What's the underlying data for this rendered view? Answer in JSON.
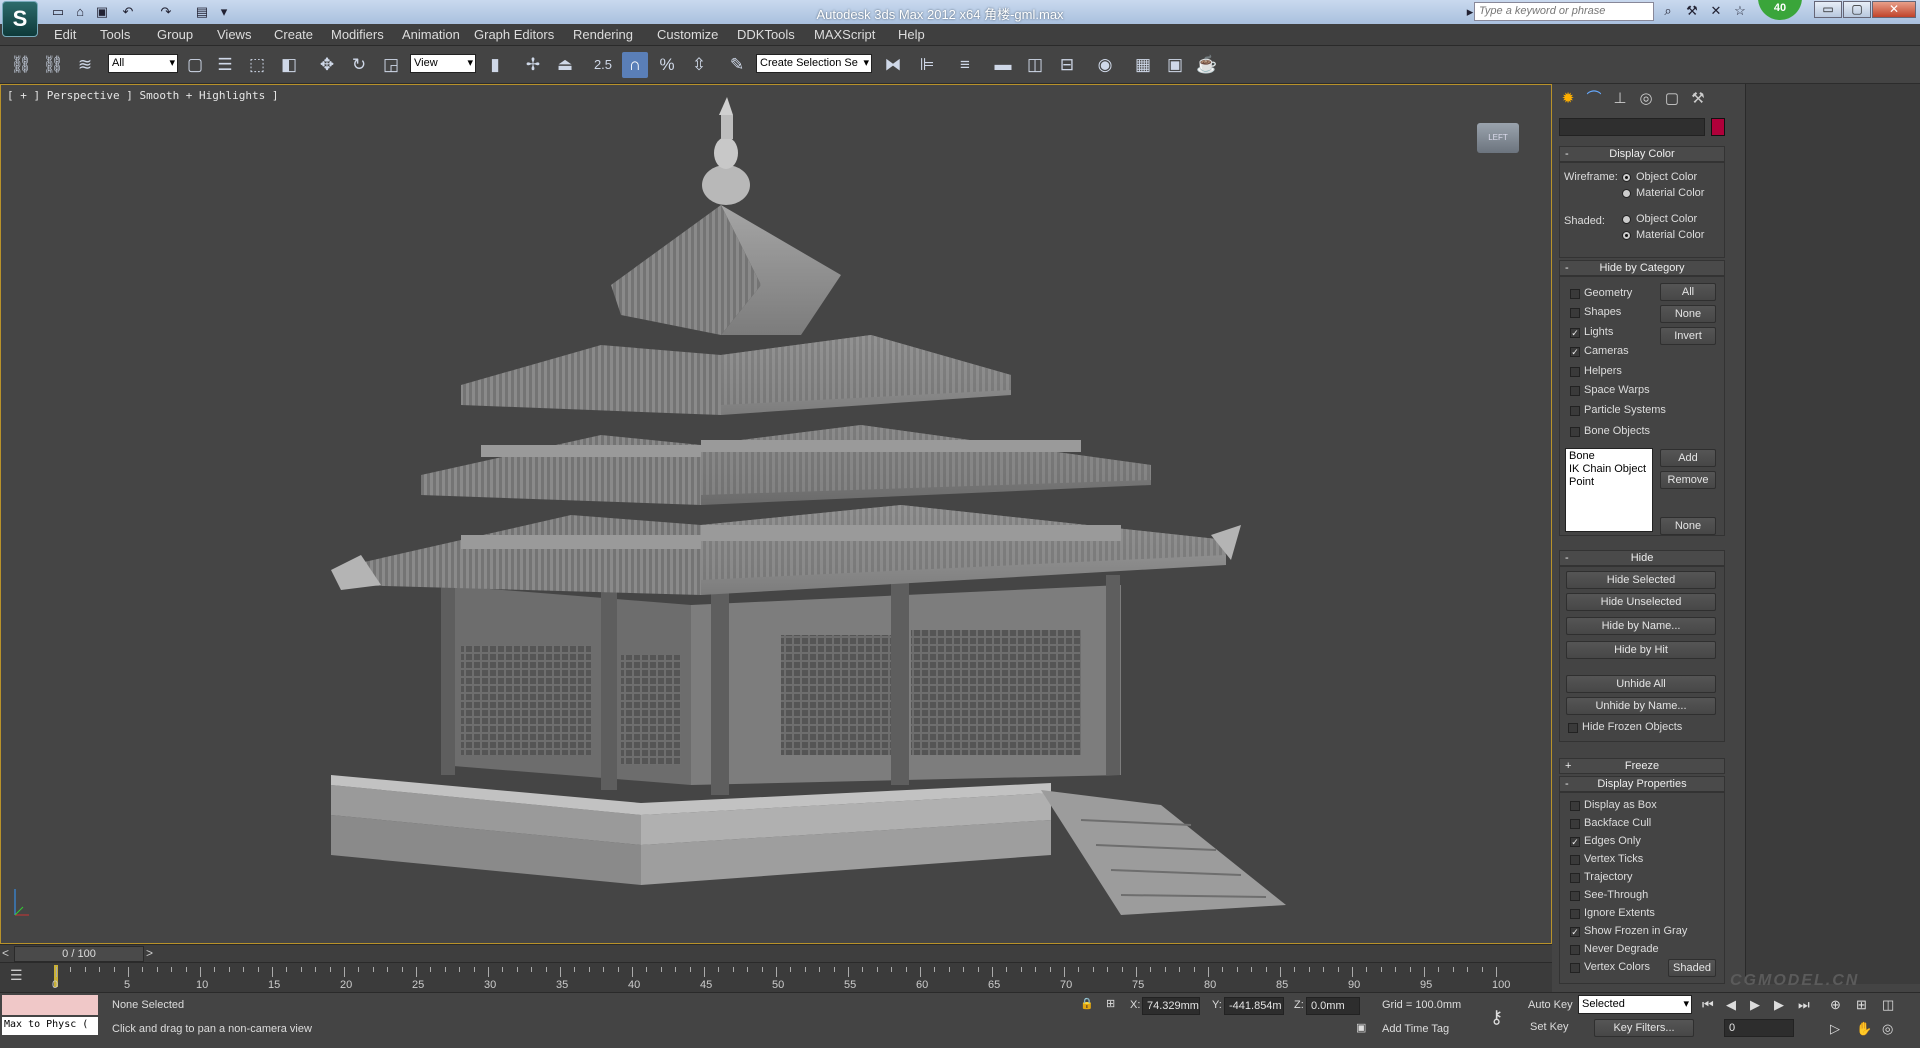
{
  "window": {
    "title": "Autodesk 3ds Max  2012 x64     角楼-gml.max",
    "logo": "S",
    "search_placeholder": "Type a keyword or phrase",
    "badge": "40",
    "min": "▭",
    "max": "▢",
    "close": "✕"
  },
  "menu": [
    "Edit",
    "Tools",
    "Group",
    "Views",
    "Create",
    "Modifiers",
    "Animation",
    "Graph Editors",
    "Rendering",
    "Customize",
    "DDKTools",
    "MAXScript",
    "Help"
  ],
  "toolbar": {
    "filter_value": "All",
    "refcoord_value": "View",
    "snap_label": "2.5",
    "percent_label": "%",
    "selection_set_value": "Create Selection Se"
  },
  "viewport": {
    "label": "[ + ] Perspective ] Smooth + Highlights ]",
    "viewcube_text": "LEFT"
  },
  "panel": {
    "display_color": {
      "title": "Display Color",
      "wireframe_label": "Wireframe:",
      "shaded_label": "Shaded:",
      "object_color": "Object Color",
      "material_color": "Material Color"
    },
    "hide_by_category": {
      "title": "Hide by Category",
      "items": [
        {
          "label": "Geometry",
          "checked": false
        },
        {
          "label": "Shapes",
          "checked": false
        },
        {
          "label": "Lights",
          "checked": true
        },
        {
          "label": "Cameras",
          "checked": true
        },
        {
          "label": "Helpers",
          "checked": false
        },
        {
          "label": "Space Warps",
          "checked": false
        },
        {
          "label": "Particle Systems",
          "checked": false
        },
        {
          "label": "Bone Objects",
          "checked": false
        }
      ],
      "all": "All",
      "none": "None",
      "invert": "Invert",
      "list": [
        "Bone",
        "IK Chain Object",
        "Point"
      ],
      "add": "Add",
      "remove": "Remove",
      "list_none": "None"
    },
    "hide": {
      "title": "Hide",
      "buttons": [
        "Hide Selected",
        "Hide Unselected",
        "Hide by Name...",
        "Hide by Hit",
        "Unhide All",
        "Unhide by Name..."
      ],
      "hide_frozen": "Hide Frozen Objects"
    },
    "freeze": {
      "title": "Freeze"
    },
    "display_properties": {
      "title": "Display Properties",
      "items": [
        {
          "label": "Display as Box",
          "checked": false
        },
        {
          "label": "Backface Cull",
          "checked": false
        },
        {
          "label": "Edges Only",
          "checked": true
        },
        {
          "label": "Vertex Ticks",
          "checked": false
        },
        {
          "label": "Trajectory",
          "checked": false
        },
        {
          "label": "See-Through",
          "checked": false
        },
        {
          "label": "Ignore Extents",
          "checked": false
        },
        {
          "label": "Show Frozen in Gray",
          "checked": true
        },
        {
          "label": "Never Degrade",
          "checked": false
        },
        {
          "label": "Vertex Colors",
          "checked": false
        }
      ],
      "shaded_btn": "Shaded"
    }
  },
  "timeline": {
    "position": "0 / 100",
    "ticks": [
      "0",
      "5",
      "10",
      "15",
      "20",
      "25",
      "30",
      "35",
      "40",
      "45",
      "50",
      "55",
      "60",
      "65",
      "70",
      "75",
      "80",
      "85",
      "90",
      "95",
      "100"
    ]
  },
  "status": {
    "maxscript_line": "Max to Physc (",
    "selection": "None Selected",
    "prompt": "Click and drag to pan a non-camera view",
    "x_label": "X:",
    "x_value": "74.329mm",
    "y_label": "Y:",
    "y_value": "-441.854m",
    "z_label": "Z:",
    "z_value": "0.0mm",
    "grid": "Grid = 100.0mm",
    "add_time_tag": "Add Time Tag",
    "auto_key": "Auto Key",
    "set_key": "Set Key",
    "selected_value": "Selected",
    "key_filters": "Key Filters...",
    "frame_value": "0"
  },
  "watermark": "CGMODEL.CN"
}
